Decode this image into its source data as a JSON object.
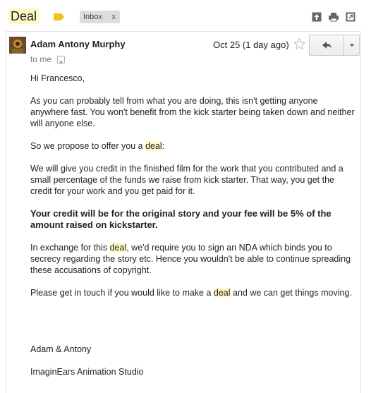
{
  "thread": {
    "subject": "Deal",
    "label_chip": "Inbox",
    "chip_remove": "x"
  },
  "message": {
    "sender": "Adam Antony Murphy",
    "to": "to me",
    "date": "Oct 25 (1 day ago)"
  },
  "body": {
    "greeting": "Hi Francesco,",
    "p1": "As you can probably tell from what you are doing, this isn't getting anyone anywhere fast. You won't benefit from the kick starter being taken down and neither will anyone else.",
    "p2_pre": "So we propose to offer you a ",
    "p2_hl": "deal",
    "p2_post": ":",
    "p3": "We will give you credit in the finished film for the work that you contributed and a small percentage of the funds we raise from kick starter. That way, you get the credit for your work and you get paid for it.",
    "p4": "Your credit will be for the original story and your fee will be 5% of the amount raised on kickstarter",
    "p4_end": ".",
    "p5_pre": "In exchange for this ",
    "p5_hl": "deal",
    "p5_post": ", we'd require you to sign an NDA which binds you to secrecy regarding the story etc. Hence you wouldn't be able to continue spreading these accusations of copyright.",
    "p6_pre": "Please get in touch if you would like to make a ",
    "p6_hl": "deal",
    "p6_post": " and we can get things moving.",
    "sign1": "Adam & Antony",
    "sign2": "ImaginEars Animation Studio"
  },
  "icons": {
    "label": "label-tag-icon",
    "new_window": "open-in-new-window-icon",
    "print": "print-icon",
    "popout": "popout-icon",
    "star": "star-icon",
    "reply": "reply-arrow-icon",
    "more": "chevron-down-icon"
  },
  "colors": {
    "highlight": "#fff9c4",
    "label_tag": "#f4c21f",
    "chip_bg": "#dddddd"
  }
}
